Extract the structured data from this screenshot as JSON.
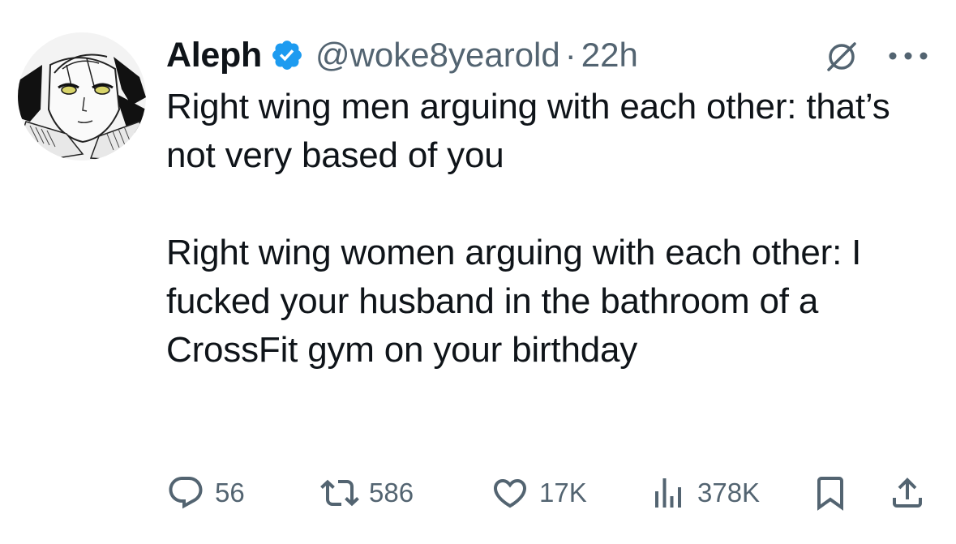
{
  "tweet": {
    "author_name": "Aleph",
    "handle": "@woke8yearold",
    "separator": "·",
    "time": "22h",
    "text_paragraphs": [
      "Right wing men arguing with each other: that’s not very based of you",
      "Right wing women arguing with each other: I fucked your husband in the bathroom of a CrossFit gym on your birthday"
    ]
  },
  "actions": {
    "replies": "56",
    "retweets": "586",
    "likes": "17K",
    "views": "378K"
  },
  "icons": {
    "verified": "verified-badge-icon",
    "grok": "grok-icon",
    "more": "more-options-icon",
    "reply": "reply-icon",
    "retweet": "retweet-icon",
    "like": "heart-icon",
    "views": "views-chart-icon",
    "bookmark": "bookmark-icon",
    "share": "share-icon"
  },
  "colors": {
    "text": "#0f1419",
    "secondary": "#536471",
    "verified": "#1d9bf0"
  }
}
